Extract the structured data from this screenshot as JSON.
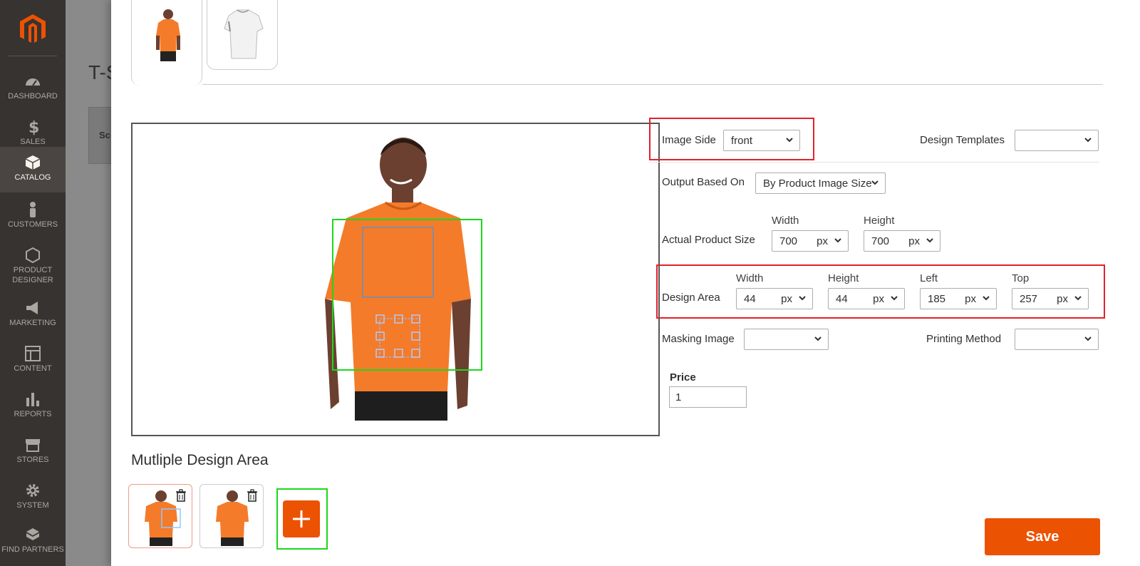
{
  "sidebar": {
    "items": [
      {
        "label": "DASHBOARD",
        "icon": "dashboard-icon"
      },
      {
        "label": "SALES",
        "icon": "dollar-icon"
      },
      {
        "label": "CATALOG",
        "icon": "cube-icon"
      },
      {
        "label": "CUSTOMERS",
        "icon": "person-icon"
      },
      {
        "label": "PRODUCT DESIGNER",
        "icon": "hexagon-icon"
      },
      {
        "label": "MARKETING",
        "icon": "megaphone-icon"
      },
      {
        "label": "CONTENT",
        "icon": "layout-icon"
      },
      {
        "label": "REPORTS",
        "icon": "bar-chart-icon"
      },
      {
        "label": "STORES",
        "icon": "store-icon"
      },
      {
        "label": "SYSTEM",
        "icon": "gear-icon"
      },
      {
        "label": "FIND PARTNERS",
        "icon": "blocks-icon"
      }
    ],
    "active": "CATALOG"
  },
  "background_page": {
    "title": "T-S",
    "box_text": "Sc"
  },
  "form": {
    "image_side_label": "Image Side",
    "image_side_value": "front",
    "design_templates_label": "Design Templates",
    "design_templates_value": "",
    "output_label": "Output Based On",
    "output_value": "By Product Image Size",
    "actual_size_label": "Actual Product Size",
    "width_label": "Width",
    "height_label": "Height",
    "actual_width": "700",
    "actual_height": "700",
    "unit": "px",
    "design_area_label": "Design Area",
    "left_label": "Left",
    "top_label": "Top",
    "area_width": "44",
    "area_height": "44",
    "area_left": "185",
    "area_top": "257",
    "masking_label": "Masking Image",
    "masking_value": "",
    "printing_label": "Printing Method",
    "printing_value": "",
    "price_label": "Price",
    "price_value": "1"
  },
  "multi_area": {
    "title": "Mutliple Design Area"
  },
  "save_label": "Save",
  "colors": {
    "accent": "#eb5202",
    "highlight_red": "#e0222b",
    "highlight_green": "#1dd71d",
    "shirt": "#f47b2a"
  }
}
